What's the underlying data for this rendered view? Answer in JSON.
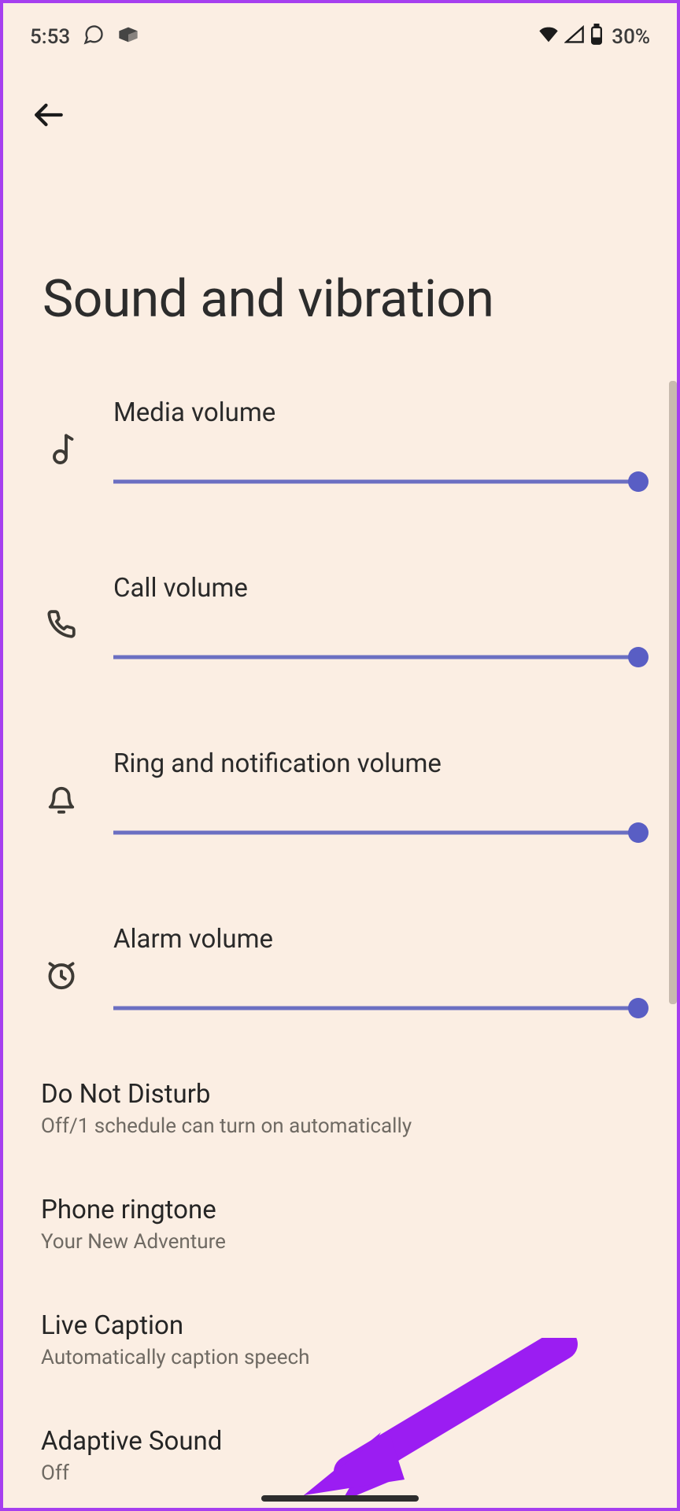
{
  "status": {
    "time": "5:53",
    "battery_pct": "30%"
  },
  "page": {
    "title": "Sound and vibration"
  },
  "sliders": [
    {
      "label": "Media volume",
      "value": 100
    },
    {
      "label": "Call volume",
      "value": 100
    },
    {
      "label": "Ring and notification volume",
      "value": 100
    },
    {
      "label": "Alarm volume",
      "value": 100
    }
  ],
  "settings": [
    {
      "title": "Do Not Disturb",
      "sub": "Off/1 schedule can turn on automatically"
    },
    {
      "title": "Phone ringtone",
      "sub": "Your New Adventure"
    },
    {
      "title": "Live Caption",
      "sub": "Automatically caption speech"
    },
    {
      "title": "Adaptive Sound",
      "sub": "Off"
    }
  ]
}
